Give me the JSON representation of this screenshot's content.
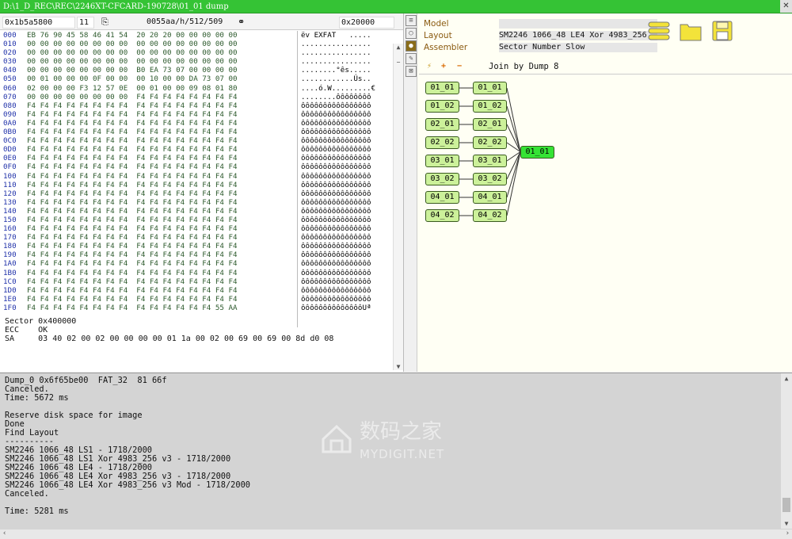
{
  "window": {
    "title": "D:\\1_D_REC\\REC\\2246XT-CFCARD-190728\\01_01 dump"
  },
  "hexbar": {
    "address": "0x1b5a5800",
    "count": "11",
    "status": "0055aa/h/512/509",
    "offset": "0x20000"
  },
  "hex_rows": [
    {
      "off": "000",
      "hex": "EB 76 90 45 58 46 41 54  20 20 20 00 00 00 00 00",
      "asc": "ëv EXFAT   ....."
    },
    {
      "off": "010",
      "hex": "00 00 00 00 00 00 00 00  00 00 00 00 00 00 00 00",
      "asc": "................"
    },
    {
      "off": "020",
      "hex": "00 00 00 00 00 00 00 00  00 00 00 00 00 00 00 00",
      "asc": "................"
    },
    {
      "off": "030",
      "hex": "00 00 00 00 00 00 00 00  00 00 00 00 00 00 00 00",
      "asc": "................"
    },
    {
      "off": "040",
      "hex": "00 00 00 00 00 00 00 00  B0 EA 73 07 00 00 00 00",
      "asc": "........°ês....."
    },
    {
      "off": "050",
      "hex": "00 01 00 00 00 0F 00 00  00 10 00 00 DA 73 07 00",
      "asc": "............Ús.."
    },
    {
      "off": "060",
      "hex": "02 00 00 00 F3 12 57 0E  00 01 00 00 09 08 01 80",
      "asc": "....ó.W.........€"
    },
    {
      "off": "070",
      "hex": "00 00 00 00 00 00 00 00  F4 F4 F4 F4 F4 F4 F4 F4",
      "asc": "........ôôôôôôôô"
    },
    {
      "off": "080",
      "hex": "F4 F4 F4 F4 F4 F4 F4 F4  F4 F4 F4 F4 F4 F4 F4 F4",
      "asc": "ôôôôôôôôôôôôôôôô"
    },
    {
      "off": "090",
      "hex": "F4 F4 F4 F4 F4 F4 F4 F4  F4 F4 F4 F4 F4 F4 F4 F4",
      "asc": "ôôôôôôôôôôôôôôôô"
    },
    {
      "off": "0A0",
      "hex": "F4 F4 F4 F4 F4 F4 F4 F4  F4 F4 F4 F4 F4 F4 F4 F4",
      "asc": "ôôôôôôôôôôôôôôôô"
    },
    {
      "off": "0B0",
      "hex": "F4 F4 F4 F4 F4 F4 F4 F4  F4 F4 F4 F4 F4 F4 F4 F4",
      "asc": "ôôôôôôôôôôôôôôôô"
    },
    {
      "off": "0C0",
      "hex": "F4 F4 F4 F4 F4 F4 F4 F4  F4 F4 F4 F4 F4 F4 F4 F4",
      "asc": "ôôôôôôôôôôôôôôôô"
    },
    {
      "off": "0D0",
      "hex": "F4 F4 F4 F4 F4 F4 F4 F4  F4 F4 F4 F4 F4 F4 F4 F4",
      "asc": "ôôôôôôôôôôôôôôôô"
    },
    {
      "off": "0E0",
      "hex": "F4 F4 F4 F4 F4 F4 F4 F4  F4 F4 F4 F4 F4 F4 F4 F4",
      "asc": "ôôôôôôôôôôôôôôôô"
    },
    {
      "off": "0F0",
      "hex": "F4 F4 F4 F4 F4 F4 F4 F4  F4 F4 F4 F4 F4 F4 F4 F4",
      "asc": "ôôôôôôôôôôôôôôôô"
    },
    {
      "off": "100",
      "hex": "F4 F4 F4 F4 F4 F4 F4 F4  F4 F4 F4 F4 F4 F4 F4 F4",
      "asc": "ôôôôôôôôôôôôôôôô"
    },
    {
      "off": "110",
      "hex": "F4 F4 F4 F4 F4 F4 F4 F4  F4 F4 F4 F4 F4 F4 F4 F4",
      "asc": "ôôôôôôôôôôôôôôôô"
    },
    {
      "off": "120",
      "hex": "F4 F4 F4 F4 F4 F4 F4 F4  F4 F4 F4 F4 F4 F4 F4 F4",
      "asc": "ôôôôôôôôôôôôôôôô"
    },
    {
      "off": "130",
      "hex": "F4 F4 F4 F4 F4 F4 F4 F4  F4 F4 F4 F4 F4 F4 F4 F4",
      "asc": "ôôôôôôôôôôôôôôôô"
    },
    {
      "off": "140",
      "hex": "F4 F4 F4 F4 F4 F4 F4 F4  F4 F4 F4 F4 F4 F4 F4 F4",
      "asc": "ôôôôôôôôôôôôôôôô"
    },
    {
      "off": "150",
      "hex": "F4 F4 F4 F4 F4 F4 F4 F4  F4 F4 F4 F4 F4 F4 F4 F4",
      "asc": "ôôôôôôôôôôôôôôôô"
    },
    {
      "off": "160",
      "hex": "F4 F4 F4 F4 F4 F4 F4 F4  F4 F4 F4 F4 F4 F4 F4 F4",
      "asc": "ôôôôôôôôôôôôôôôô"
    },
    {
      "off": "170",
      "hex": "F4 F4 F4 F4 F4 F4 F4 F4  F4 F4 F4 F4 F4 F4 F4 F4",
      "asc": "ôôôôôôôôôôôôôôôô"
    },
    {
      "off": "180",
      "hex": "F4 F4 F4 F4 F4 F4 F4 F4  F4 F4 F4 F4 F4 F4 F4 F4",
      "asc": "ôôôôôôôôôôôôôôôô"
    },
    {
      "off": "190",
      "hex": "F4 F4 F4 F4 F4 F4 F4 F4  F4 F4 F4 F4 F4 F4 F4 F4",
      "asc": "ôôôôôôôôôôôôôôôô"
    },
    {
      "off": "1A0",
      "hex": "F4 F4 F4 F4 F4 F4 F4 F4  F4 F4 F4 F4 F4 F4 F4 F4",
      "asc": "ôôôôôôôôôôôôôôôô"
    },
    {
      "off": "1B0",
      "hex": "F4 F4 F4 F4 F4 F4 F4 F4  F4 F4 F4 F4 F4 F4 F4 F4",
      "asc": "ôôôôôôôôôôôôôôôô"
    },
    {
      "off": "1C0",
      "hex": "F4 F4 F4 F4 F4 F4 F4 F4  F4 F4 F4 F4 F4 F4 F4 F4",
      "asc": "ôôôôôôôôôôôôôôôô"
    },
    {
      "off": "1D0",
      "hex": "F4 F4 F4 F4 F4 F4 F4 F4  F4 F4 F4 F4 F4 F4 F4 F4",
      "asc": "ôôôôôôôôôôôôôôôô"
    },
    {
      "off": "1E0",
      "hex": "F4 F4 F4 F4 F4 F4 F4 F4  F4 F4 F4 F4 F4 F4 F4 F4",
      "asc": "ôôôôôôôôôôôôôôôô"
    },
    {
      "off": "1F0",
      "hex": "F4 F4 F4 F4 F4 F4 F4 F4  F4 F4 F4 F4 F4 F4 55 AA",
      "asc": "ôôôôôôôôôôôôôôUª"
    }
  ],
  "hex_footer": {
    "sector_label": "Sector",
    "sector_value": "0x400000",
    "ecc_label": "ECC",
    "ecc_value": "OK",
    "sa_label": "SA",
    "sa_value": "03 40 02 00 02 00 00 00 00 01 1a 00 02 00 69 00 69 00 8d d0 08"
  },
  "props": {
    "model_label": "Model",
    "model_value": "",
    "layout_label": "Layout",
    "layout_value": "SM2246 1066_48 LE4 Xor 4983_256",
    "assembler_label": "Assembler",
    "assembler_value": "Sector Number Slow"
  },
  "graph_toolbar": {
    "plus": "+",
    "minus": "−",
    "title": "Join by Dump 8"
  },
  "graph": {
    "left_nodes": [
      "01_01",
      "01_02",
      "02_01",
      "02_02",
      "03_01",
      "03_02",
      "04_01",
      "04_02"
    ],
    "mid_nodes": [
      "01_01",
      "01_02",
      "02_01",
      "02_02",
      "03_01",
      "03_02",
      "04_01",
      "04_02"
    ],
    "result_node": "01_01"
  },
  "log_lines": [
    "Dump_0 0x6f65be00  FAT_32  81 66f",
    "Canceled.",
    "Time: 5672 ms",
    "",
    "Reserve disk space for image",
    "Done",
    "Find Layout",
    "----------",
    "SM2246 1066_48 LS1 - 1718/2000",
    "SM2246 1066_48 LS1 Xor 4983_256 v3 - 1718/2000",
    "SM2246 1066_48 LE4 - 1718/2000",
    "SM2246 1066_48 LE4 Xor 4983_256 v3 - 1718/2000",
    "SM2246 1066_48 LE4 Xor 4983_256 v3 Mod - 1718/2000",
    "Canceled.",
    "",
    "Time: 5281 ms"
  ],
  "watermark": {
    "cn": "数码之家",
    "en": "MYDIGIT.NET"
  },
  "colors": {
    "titlebar": "#35c335",
    "node": "#ccf19a",
    "node_selected": "#35e335"
  }
}
